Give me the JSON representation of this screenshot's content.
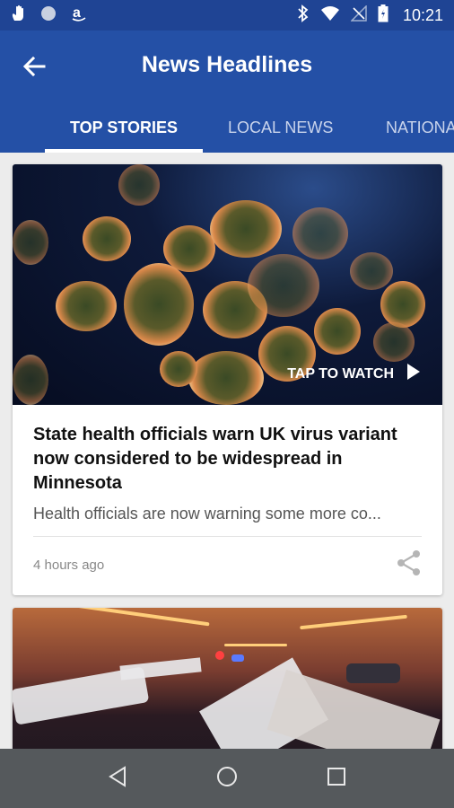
{
  "status_bar": {
    "time": "10:21",
    "left_icons": [
      "hand-notification-icon",
      "circle-notification-icon",
      "amazon-icon"
    ],
    "right_icons": [
      "bluetooth-icon",
      "wifi-icon",
      "no-signal-icon",
      "battery-icon"
    ]
  },
  "app_bar": {
    "title": "News Headlines",
    "back_icon": "arrow-back-icon"
  },
  "tabs": [
    {
      "label": "TOP STORIES",
      "selected": true
    },
    {
      "label": "LOCAL NEWS",
      "selected": false
    },
    {
      "label": "NATIONAL",
      "selected": false
    }
  ],
  "articles": [
    {
      "image_overlay": "TAP TO WATCH",
      "headline": "State health officials warn UK virus variant now considered to be widespread in Minnesota",
      "summary": "Health officials are now warning some more co...",
      "time_ago": "4 hours ago",
      "share_icon": "share-icon"
    }
  ],
  "nav_bar": {
    "icons": [
      "back-triangle-icon",
      "home-circle-icon",
      "recents-square-icon"
    ]
  },
  "colors": {
    "app_bar": "#2450a6",
    "status_bar": "#1f4494",
    "nav_bar": "#55595c"
  }
}
